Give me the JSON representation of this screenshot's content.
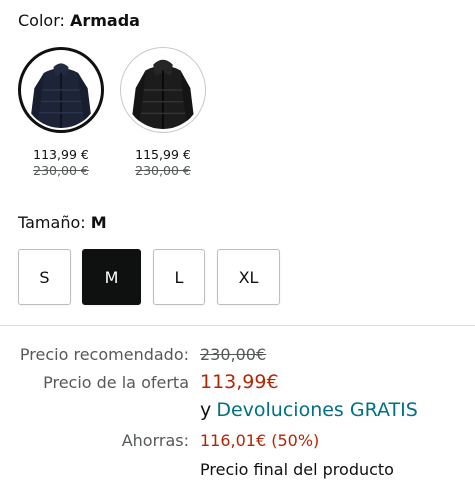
{
  "color": {
    "label": "Color:",
    "value": "Armada"
  },
  "variants": [
    {
      "name": "Armada",
      "price": "113,99 €",
      "old_price": "230,00 €",
      "selected": true
    },
    {
      "name": "Negro",
      "price": "115,99 €",
      "old_price": "230,00 €",
      "selected": false
    }
  ],
  "size": {
    "label": "Tamaño:",
    "value": "M",
    "options": [
      "S",
      "M",
      "L",
      "XL"
    ],
    "selected": "M"
  },
  "pricing": {
    "recommended_label": "Precio recomendado:",
    "recommended_value": "230,00€",
    "deal_label": "Precio de la oferta",
    "deal_value": "113,99€",
    "returns_prefix": "y",
    "returns_link": "Devoluciones GRATIS",
    "savings_label": "Ahorras:",
    "savings_value": "116,01€ (50%)",
    "final_note": "Precio final del producto"
  },
  "colors": {
    "accent_price": "#b12704",
    "link": "#007185",
    "selected_fill": "#0f1111"
  }
}
